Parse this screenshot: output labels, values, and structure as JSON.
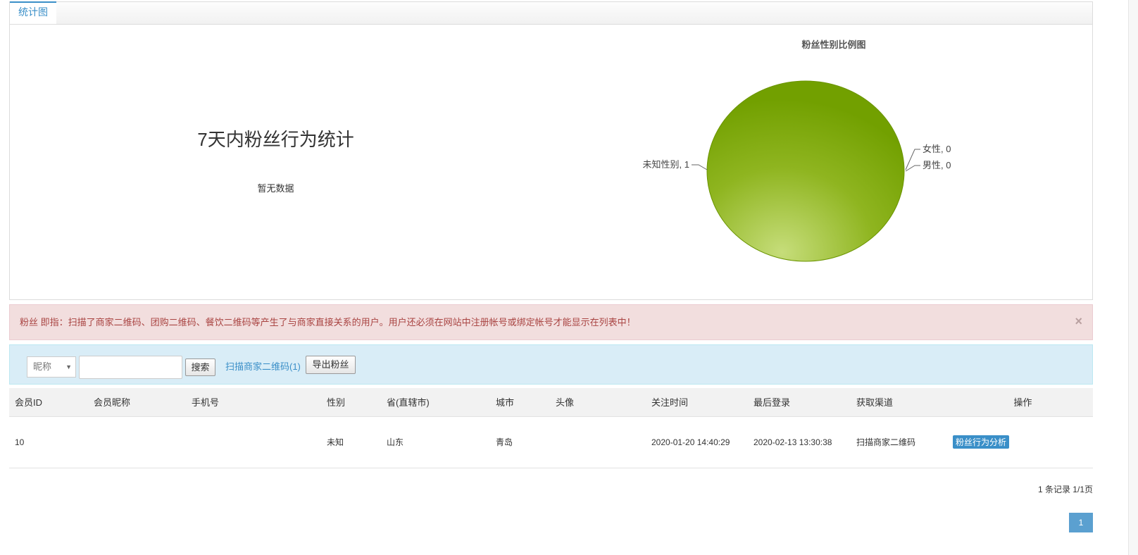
{
  "stats": {
    "tab_label": "统计图",
    "behavior_title": "7天内粉丝行为统计",
    "behavior_empty": "暂无数据"
  },
  "chart_data": {
    "type": "pie",
    "title": "粉丝性别比例图",
    "labels": [
      "未知性别",
      "女性",
      "男性"
    ],
    "values": [
      1,
      0,
      0
    ],
    "data_labels": [
      "未知性别, 1",
      "女性, 0",
      "男性, 0"
    ],
    "colors": [
      "#77a000",
      "#4572a7",
      "#aa4643"
    ]
  },
  "alert": {
    "text": "粉丝 即指：扫描了商家二维码、团购二维码、餐饮二维码等产生了与商家直接关系的用户。用户还必须在网站中注册帐号或绑定帐号才能显示在列表中！",
    "close": "×"
  },
  "search": {
    "field_select": "昵称",
    "keyword_value": "",
    "search_label": "搜索",
    "qr_link": "扫描商家二维码(1)",
    "export_label": "导出粉丝"
  },
  "table": {
    "headers": [
      "会员ID",
      "会员昵称",
      "手机号",
      "性别",
      "省(直辖市)",
      "城市",
      "头像",
      "关注时间",
      "最后登录",
      "获取渠道",
      "操作"
    ],
    "rows": [
      {
        "id": "10",
        "nickname": "",
        "phone": "",
        "gender": "未知",
        "province": "山东",
        "city": "青岛",
        "avatar": "",
        "follow_time": "2020-01-20 14:40:29",
        "last_login": "2020-02-13 13:30:38",
        "channel": "扫描商家二维码",
        "action": "粉丝行为分析"
      }
    ]
  },
  "pager": {
    "info": "1 条记录 1/1页",
    "current_page": "1"
  }
}
